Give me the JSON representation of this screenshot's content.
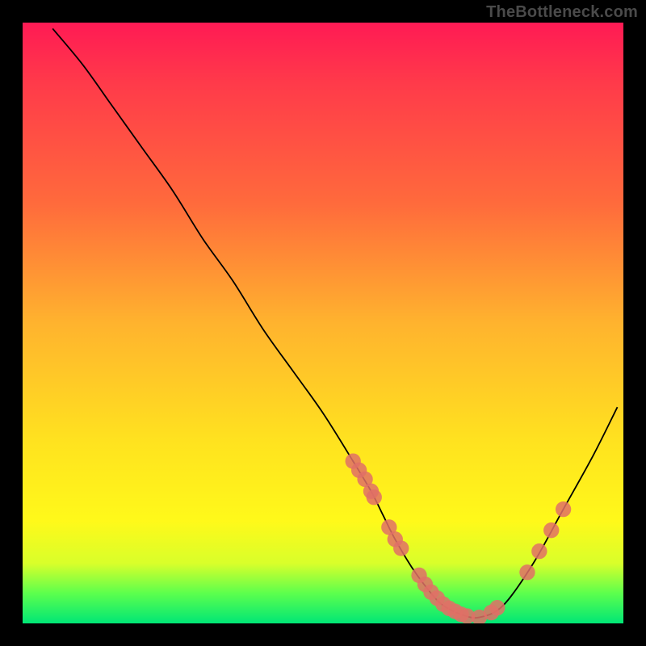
{
  "watermark": "TheBottleneck.com",
  "chart_data": {
    "type": "line",
    "title": "",
    "xlabel": "",
    "ylabel": "",
    "xlim": [
      0,
      100
    ],
    "ylim": [
      0,
      100
    ],
    "curve": {
      "name": "bottleneck-curve",
      "x": [
        5,
        10,
        15,
        20,
        25,
        30,
        35,
        40,
        45,
        50,
        55,
        58,
        60,
        62,
        65,
        68,
        70,
        73,
        76,
        80,
        85,
        90,
        95,
        99
      ],
      "y": [
        99,
        93,
        86,
        79,
        72,
        64,
        57,
        49,
        42,
        35,
        27,
        22,
        18,
        14,
        9,
        5,
        3,
        1.5,
        1,
        3,
        10,
        19,
        28,
        36
      ]
    },
    "markers": {
      "name": "data-points",
      "color": "#e07066",
      "radius": 1.3,
      "x": [
        55,
        56,
        57,
        58,
        58.5,
        61,
        62,
        63,
        66,
        67,
        68,
        69,
        70,
        71,
        72,
        73,
        74,
        76,
        78,
        79,
        84,
        86,
        88,
        90
      ],
      "y": [
        27,
        25.5,
        24,
        22,
        21,
        16,
        14,
        12.5,
        8,
        6.5,
        5.2,
        4.2,
        3.2,
        2.5,
        2.0,
        1.5,
        1.2,
        1.0,
        1.8,
        2.6,
        8.5,
        12,
        15.5,
        19
      ]
    }
  }
}
